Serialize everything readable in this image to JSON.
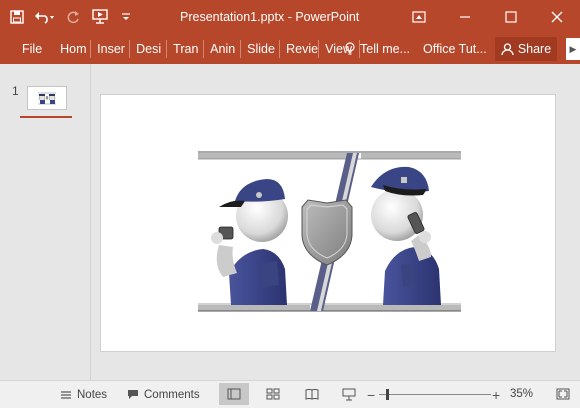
{
  "window": {
    "title": "Presentation1.pptx - PowerPoint",
    "accent": "#b7472a"
  },
  "qat": {
    "save_icon": "save-icon",
    "undo_icon": "undo-icon",
    "redo_icon": "redo-icon",
    "present_icon": "present-from-start-icon",
    "customize_icon": "customize-qat-icon"
  },
  "ribbon": {
    "file": "File",
    "tabs": [
      "Hom",
      "Inser",
      "Desi",
      "Tran",
      "Anin",
      "Slide",
      "Revie",
      "View"
    ],
    "tellme": "Tell me...",
    "office_tut": "Office Tut...",
    "share": "Share"
  },
  "thumbnails": {
    "items": [
      {
        "number": "1"
      }
    ]
  },
  "status": {
    "notes": "Notes",
    "comments": "Comments",
    "zoom_percent": "35%",
    "zoom_level": 0.35
  }
}
